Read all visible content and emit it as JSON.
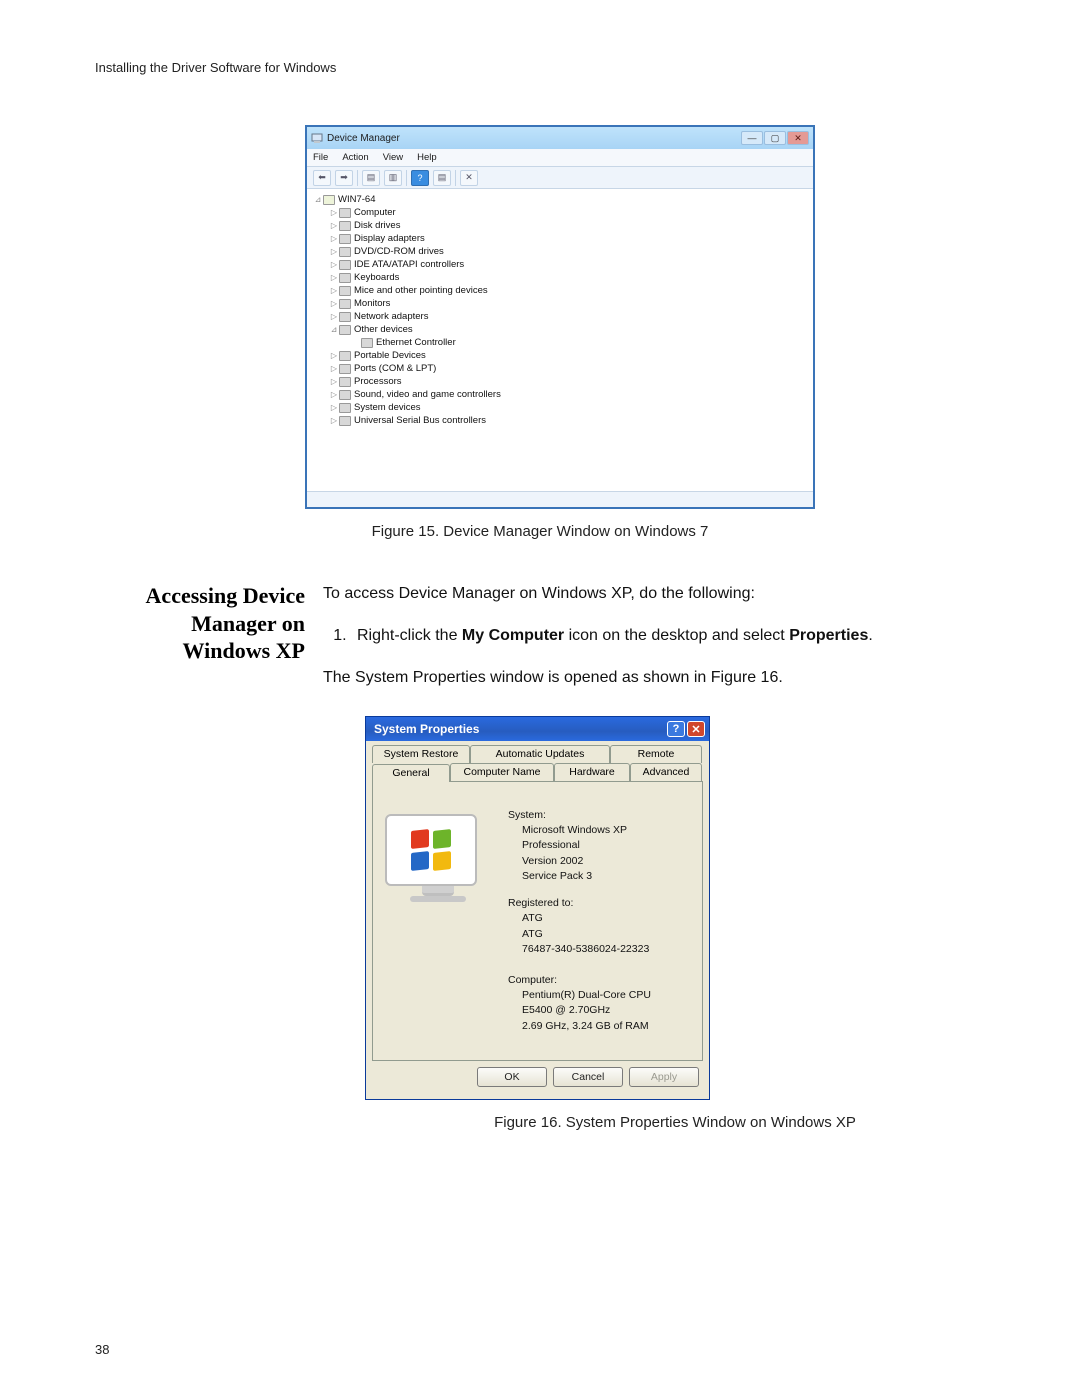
{
  "page": {
    "header": "Installing the Driver Software for Windows",
    "number": "38"
  },
  "fig1": {
    "caption": "Figure 15. Device Manager Window on Windows 7",
    "window_title": "Device Manager",
    "menus": [
      "File",
      "Action",
      "View",
      "Help"
    ],
    "root": "WIN7-64",
    "nodes": [
      {
        "label": "Computer",
        "icon": "computer-icon"
      },
      {
        "label": "Disk drives",
        "icon": "disk-icon"
      },
      {
        "label": "Display adapters",
        "icon": "display-icon"
      },
      {
        "label": "DVD/CD-ROM drives",
        "icon": "dvd-icon"
      },
      {
        "label": "IDE ATA/ATAPI controllers",
        "icon": "ide-icon"
      },
      {
        "label": "Keyboards",
        "icon": "keyboard-icon"
      },
      {
        "label": "Mice and other pointing devices",
        "icon": "mouse-icon"
      },
      {
        "label": "Monitors",
        "icon": "monitor-icon"
      },
      {
        "label": "Network adapters",
        "icon": "network-icon"
      },
      {
        "label": "Other devices",
        "icon": "other-icon",
        "expanded": true
      },
      {
        "label": "Ethernet Controller",
        "icon": "ethernet-icon",
        "child": true
      },
      {
        "label": "Portable Devices",
        "icon": "portable-icon"
      },
      {
        "label": "Ports (COM & LPT)",
        "icon": "ports-icon"
      },
      {
        "label": "Processors",
        "icon": "processor-icon"
      },
      {
        "label": "Sound, video and game controllers",
        "icon": "sound-icon"
      },
      {
        "label": "System devices",
        "icon": "system-icon"
      },
      {
        "label": "Universal Serial Bus controllers",
        "icon": "usb-icon"
      }
    ]
  },
  "section": {
    "heading_l1": "Accessing Device",
    "heading_l2": "Manager on",
    "heading_l3": "Windows XP",
    "intro": "To access Device Manager on Windows XP, do the following:",
    "step1_a": "Right-click the ",
    "step1_b": "My Computer",
    "step1_c": " icon on the desktop and select ",
    "step1_d": "Properties",
    "step1_e": ".",
    "after": "The System Properties window is opened as shown in Figure 16."
  },
  "fig2": {
    "caption": "Figure 16. System Properties Window on Windows XP",
    "window_title": "System Properties",
    "tabs_row1": [
      "System Restore",
      "Automatic Updates",
      "Remote"
    ],
    "tabs_row2": [
      "General",
      "Computer Name",
      "Hardware",
      "Advanced"
    ],
    "system_heading": "System:",
    "system_lines": [
      "Microsoft Windows XP",
      "Professional",
      "Version 2002",
      "Service Pack 3"
    ],
    "registered_heading": "Registered to:",
    "registered_lines": [
      "ATG",
      "ATG",
      "76487-340-5386024-22323"
    ],
    "computer_heading": "Computer:",
    "computer_lines": [
      "Pentium(R) Dual-Core  CPU",
      "E5400  @ 2.70GHz",
      "2.69 GHz, 3.24 GB of RAM"
    ],
    "buttons": {
      "ok": "OK",
      "cancel": "Cancel",
      "apply": "Apply"
    }
  }
}
